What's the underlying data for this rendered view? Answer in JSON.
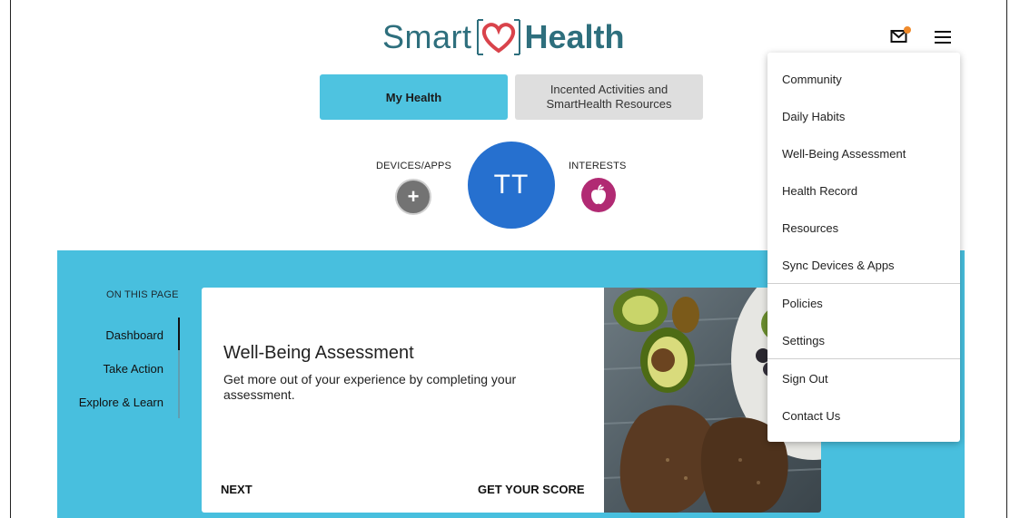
{
  "header": {
    "logo_part1": "Smart",
    "logo_part2": "Health",
    "mail_icon": "mail-icon",
    "menu_icon": "hamburger-icon",
    "notification_color": "#f08a2a"
  },
  "tabs": [
    {
      "label": "My Health",
      "active": true
    },
    {
      "label": "Incented Activities and SmartHealth Resources",
      "active": false
    }
  ],
  "profile": {
    "devices_label": "DEVICES/APPS",
    "devices_button": "+",
    "initials": "TT",
    "interests_label": "INTERESTS",
    "interests_icon": "apple-icon"
  },
  "sidebar": {
    "heading": "ON THIS PAGE",
    "items": [
      {
        "label": "Dashboard",
        "active": true
      },
      {
        "label": "Take Action",
        "active": false
      },
      {
        "label": "Explore & Learn",
        "active": false
      }
    ]
  },
  "card": {
    "title": "Well-Being Assessment",
    "description": "Get more out of your experience by completing your assessment.",
    "next_label": "NEXT",
    "score_label": "GET YOUR SCORE"
  },
  "menu": {
    "items": [
      "Community",
      "Daily Habits",
      "Well-Being Assessment",
      "Health Record",
      "Resources",
      "Sync Devices & Apps",
      "Policies",
      "Settings",
      "Sign Out",
      "Contact Us"
    ]
  },
  "colors": {
    "accent": "#48bfde",
    "active_tab": "#4ec3e0",
    "avatar": "#2670cf",
    "interests": "#b12a73",
    "logo": "#2e6f7d"
  }
}
